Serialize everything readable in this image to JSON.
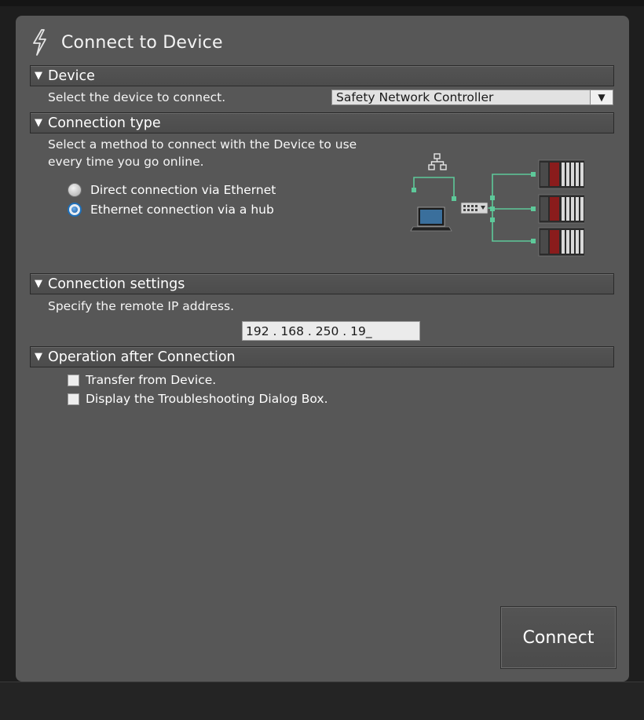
{
  "dialog": {
    "title": "Connect to Device",
    "title_icon": "lightning-icon"
  },
  "device_section": {
    "title": "Device",
    "prompt": "Select the device to connect.",
    "device_select": {
      "value": "Safety Network Controller"
    }
  },
  "connection_type_section": {
    "title": "Connection type",
    "description_line1": "Select a method to connect with the Device to use",
    "description_line2": "every time you go online.",
    "options": [
      {
        "label": "Direct connection via Ethernet",
        "selected": false
      },
      {
        "label": "Ethernet connection via a hub",
        "selected": true
      }
    ],
    "diagram_icons": [
      "network-icon",
      "laptop-icon",
      "hub-icon",
      "controller-icon"
    ]
  },
  "connection_settings_section": {
    "title": "Connection settings",
    "prompt": "Specify the remote IP address.",
    "ip_address": "192 . 168 . 250 . 19_"
  },
  "operation_section": {
    "title": "Operation after Connection",
    "options": [
      {
        "label": "Transfer from Device.",
        "checked": false
      },
      {
        "label": "Display the Troubleshooting Dialog Box.",
        "checked": false
      }
    ]
  },
  "actions": {
    "connect_label": "Connect"
  },
  "colors": {
    "panel_bg": "#575757",
    "app_bg": "#1e1e1e",
    "accent_green": "#5ec99a",
    "radio_selected": "#1e6fb8"
  }
}
